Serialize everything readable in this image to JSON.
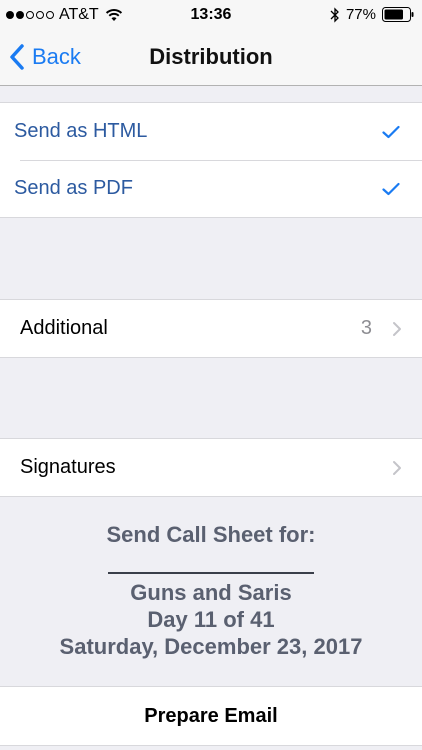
{
  "status_bar": {
    "carrier": "AT&T",
    "signal_bars_filled": 2,
    "signal_bars_total": 5,
    "time": "13:36",
    "battery_percent": "77%",
    "battery_level": 0.77
  },
  "nav": {
    "back_label": "Back",
    "title": "Distribution"
  },
  "format_options": [
    {
      "label": "Send as HTML",
      "checked": true
    },
    {
      "label": "Send as PDF",
      "checked": true
    }
  ],
  "additional": {
    "label": "Additional",
    "count": "3"
  },
  "signatures": {
    "label": "Signatures"
  },
  "call_sheet": {
    "heading": "Send Call Sheet for:",
    "production": "Guns and Saris",
    "day": "Day 11 of 41",
    "date": "Saturday, December 23, 2017"
  },
  "prepare_button": "Prepare Email",
  "colors": {
    "accent": "#1a7bf2",
    "option_text": "#2c5aa0",
    "info_text": "#5a6070",
    "background": "#efeff4"
  }
}
